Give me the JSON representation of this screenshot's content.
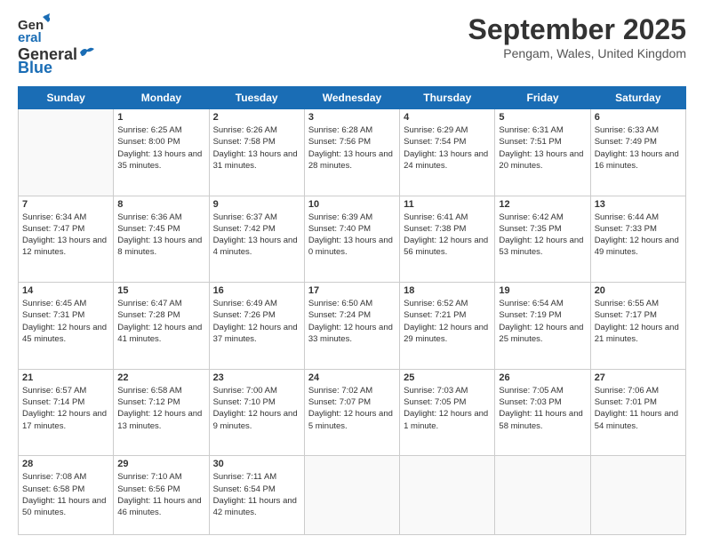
{
  "header": {
    "logo_general": "General",
    "logo_blue": "Blue",
    "month": "September 2025",
    "location": "Pengam, Wales, United Kingdom"
  },
  "days_of_week": [
    "Sunday",
    "Monday",
    "Tuesday",
    "Wednesday",
    "Thursday",
    "Friday",
    "Saturday"
  ],
  "weeks": [
    [
      {
        "day": "",
        "empty": true
      },
      {
        "day": "1",
        "sunrise": "Sunrise: 6:25 AM",
        "sunset": "Sunset: 8:00 PM",
        "daylight": "Daylight: 13 hours and 35 minutes."
      },
      {
        "day": "2",
        "sunrise": "Sunrise: 6:26 AM",
        "sunset": "Sunset: 7:58 PM",
        "daylight": "Daylight: 13 hours and 31 minutes."
      },
      {
        "day": "3",
        "sunrise": "Sunrise: 6:28 AM",
        "sunset": "Sunset: 7:56 PM",
        "daylight": "Daylight: 13 hours and 28 minutes."
      },
      {
        "day": "4",
        "sunrise": "Sunrise: 6:29 AM",
        "sunset": "Sunset: 7:54 PM",
        "daylight": "Daylight: 13 hours and 24 minutes."
      },
      {
        "day": "5",
        "sunrise": "Sunrise: 6:31 AM",
        "sunset": "Sunset: 7:51 PM",
        "daylight": "Daylight: 13 hours and 20 minutes."
      },
      {
        "day": "6",
        "sunrise": "Sunrise: 6:33 AM",
        "sunset": "Sunset: 7:49 PM",
        "daylight": "Daylight: 13 hours and 16 minutes."
      }
    ],
    [
      {
        "day": "7",
        "sunrise": "Sunrise: 6:34 AM",
        "sunset": "Sunset: 7:47 PM",
        "daylight": "Daylight: 13 hours and 12 minutes."
      },
      {
        "day": "8",
        "sunrise": "Sunrise: 6:36 AM",
        "sunset": "Sunset: 7:45 PM",
        "daylight": "Daylight: 13 hours and 8 minutes."
      },
      {
        "day": "9",
        "sunrise": "Sunrise: 6:37 AM",
        "sunset": "Sunset: 7:42 PM",
        "daylight": "Daylight: 13 hours and 4 minutes."
      },
      {
        "day": "10",
        "sunrise": "Sunrise: 6:39 AM",
        "sunset": "Sunset: 7:40 PM",
        "daylight": "Daylight: 13 hours and 0 minutes."
      },
      {
        "day": "11",
        "sunrise": "Sunrise: 6:41 AM",
        "sunset": "Sunset: 7:38 PM",
        "daylight": "Daylight: 12 hours and 56 minutes."
      },
      {
        "day": "12",
        "sunrise": "Sunrise: 6:42 AM",
        "sunset": "Sunset: 7:35 PM",
        "daylight": "Daylight: 12 hours and 53 minutes."
      },
      {
        "day": "13",
        "sunrise": "Sunrise: 6:44 AM",
        "sunset": "Sunset: 7:33 PM",
        "daylight": "Daylight: 12 hours and 49 minutes."
      }
    ],
    [
      {
        "day": "14",
        "sunrise": "Sunrise: 6:45 AM",
        "sunset": "Sunset: 7:31 PM",
        "daylight": "Daylight: 12 hours and 45 minutes."
      },
      {
        "day": "15",
        "sunrise": "Sunrise: 6:47 AM",
        "sunset": "Sunset: 7:28 PM",
        "daylight": "Daylight: 12 hours and 41 minutes."
      },
      {
        "day": "16",
        "sunrise": "Sunrise: 6:49 AM",
        "sunset": "Sunset: 7:26 PM",
        "daylight": "Daylight: 12 hours and 37 minutes."
      },
      {
        "day": "17",
        "sunrise": "Sunrise: 6:50 AM",
        "sunset": "Sunset: 7:24 PM",
        "daylight": "Daylight: 12 hours and 33 minutes."
      },
      {
        "day": "18",
        "sunrise": "Sunrise: 6:52 AM",
        "sunset": "Sunset: 7:21 PM",
        "daylight": "Daylight: 12 hours and 29 minutes."
      },
      {
        "day": "19",
        "sunrise": "Sunrise: 6:54 AM",
        "sunset": "Sunset: 7:19 PM",
        "daylight": "Daylight: 12 hours and 25 minutes."
      },
      {
        "day": "20",
        "sunrise": "Sunrise: 6:55 AM",
        "sunset": "Sunset: 7:17 PM",
        "daylight": "Daylight: 12 hours and 21 minutes."
      }
    ],
    [
      {
        "day": "21",
        "sunrise": "Sunrise: 6:57 AM",
        "sunset": "Sunset: 7:14 PM",
        "daylight": "Daylight: 12 hours and 17 minutes."
      },
      {
        "day": "22",
        "sunrise": "Sunrise: 6:58 AM",
        "sunset": "Sunset: 7:12 PM",
        "daylight": "Daylight: 12 hours and 13 minutes."
      },
      {
        "day": "23",
        "sunrise": "Sunrise: 7:00 AM",
        "sunset": "Sunset: 7:10 PM",
        "daylight": "Daylight: 12 hours and 9 minutes."
      },
      {
        "day": "24",
        "sunrise": "Sunrise: 7:02 AM",
        "sunset": "Sunset: 7:07 PM",
        "daylight": "Daylight: 12 hours and 5 minutes."
      },
      {
        "day": "25",
        "sunrise": "Sunrise: 7:03 AM",
        "sunset": "Sunset: 7:05 PM",
        "daylight": "Daylight: 12 hours and 1 minute."
      },
      {
        "day": "26",
        "sunrise": "Sunrise: 7:05 AM",
        "sunset": "Sunset: 7:03 PM",
        "daylight": "Daylight: 11 hours and 58 minutes."
      },
      {
        "day": "27",
        "sunrise": "Sunrise: 7:06 AM",
        "sunset": "Sunset: 7:01 PM",
        "daylight": "Daylight: 11 hours and 54 minutes."
      }
    ],
    [
      {
        "day": "28",
        "sunrise": "Sunrise: 7:08 AM",
        "sunset": "Sunset: 6:58 PM",
        "daylight": "Daylight: 11 hours and 50 minutes."
      },
      {
        "day": "29",
        "sunrise": "Sunrise: 7:10 AM",
        "sunset": "Sunset: 6:56 PM",
        "daylight": "Daylight: 11 hours and 46 minutes."
      },
      {
        "day": "30",
        "sunrise": "Sunrise: 7:11 AM",
        "sunset": "Sunset: 6:54 PM",
        "daylight": "Daylight: 11 hours and 42 minutes."
      },
      {
        "day": "",
        "empty": true
      },
      {
        "day": "",
        "empty": true
      },
      {
        "day": "",
        "empty": true
      },
      {
        "day": "",
        "empty": true
      }
    ]
  ]
}
